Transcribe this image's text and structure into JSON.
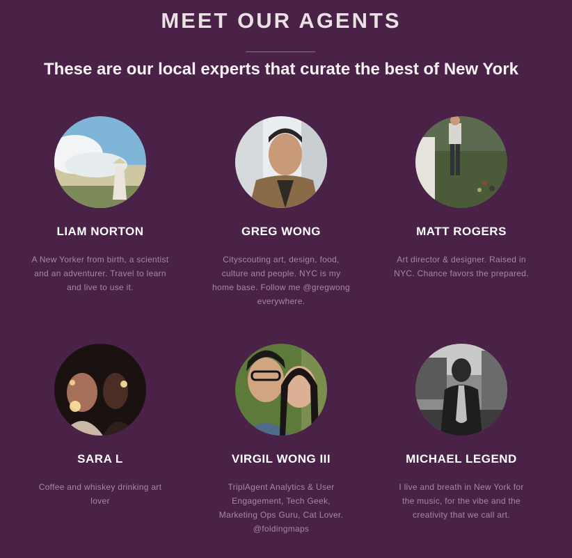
{
  "header": {
    "title": "MEET OUR AGENTS",
    "subtitle": "These are our local experts that curate the best of New York"
  },
  "agents": [
    {
      "name": "LIAM NORTON",
      "bio": "A New Yorker from birth, a scientist and an adventurer. Travel to learn and live to use it.",
      "avatar": "anime-sky-avatar"
    },
    {
      "name": "GREG WONG",
      "bio": "Cityscouting art, design, food, culture and people. NYC is my home base. Follow me @gregwong everywhere.",
      "avatar": "selfie-avatar"
    },
    {
      "name": "MATT ROGERS",
      "bio": "Art director & designer. Raised in NYC. Chance favors the prepared.",
      "avatar": "bocce-avatar"
    },
    {
      "name": "SARA L",
      "bio": "Coffee and whiskey drinking art lover",
      "avatar": "sparkler-avatar"
    },
    {
      "name": "VIRGIL WONG III",
      "bio": "TriplAgent Analytics & User Engagement, Tech Geek, Marketing Ops Guru, Cat Lover. @foldingmaps",
      "avatar": "couple-avatar"
    },
    {
      "name": "MICHAEL LEGEND",
      "bio": "I live and breath in New York for the music, for the vibe and the creativity that we call art.",
      "avatar": "saxophone-avatar"
    }
  ],
  "colors": {
    "background": "#4a2147",
    "bio_text": "#a58aa3",
    "name_text": "#ffffff"
  }
}
